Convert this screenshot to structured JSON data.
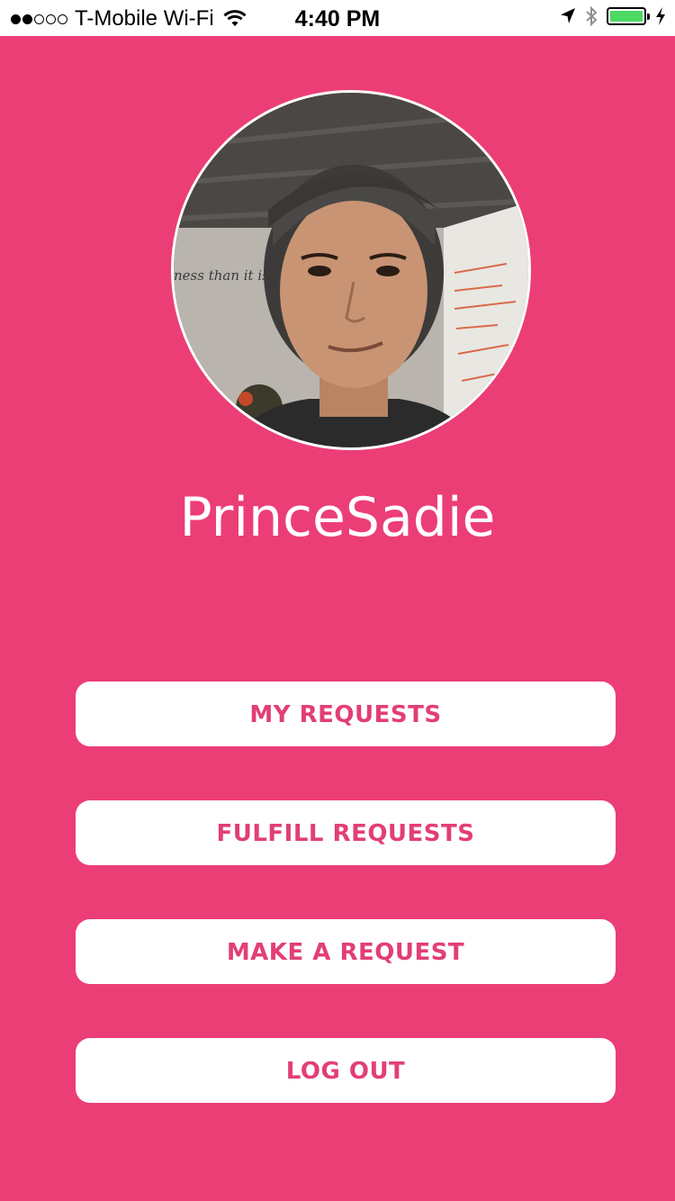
{
  "status_bar": {
    "carrier": "T-Mobile Wi-Fi",
    "time": "4:40 PM",
    "signal_bars_filled": 2,
    "signal_bars_total": 5,
    "battery_level": 1.0,
    "icons": [
      "wifi-icon",
      "location-arrow-icon",
      "bluetooth-icon",
      "battery-icon",
      "charging-bolt-icon"
    ]
  },
  "profile": {
    "avatar": "profile-photo",
    "username": "PrinceSadie",
    "photo_whiteboard_text": "ness than it is t"
  },
  "menu": {
    "my_requests": "MY REQUESTS",
    "fulfill_requests": "FULFILL REQUESTS",
    "make_request": "MAKE A REQUEST",
    "log_out": "LOG OUT"
  },
  "colors": {
    "background": "#EC3E76",
    "button_bg": "#FFFFFF",
    "button_text": "#E23E78",
    "battery": "#4CD964"
  }
}
